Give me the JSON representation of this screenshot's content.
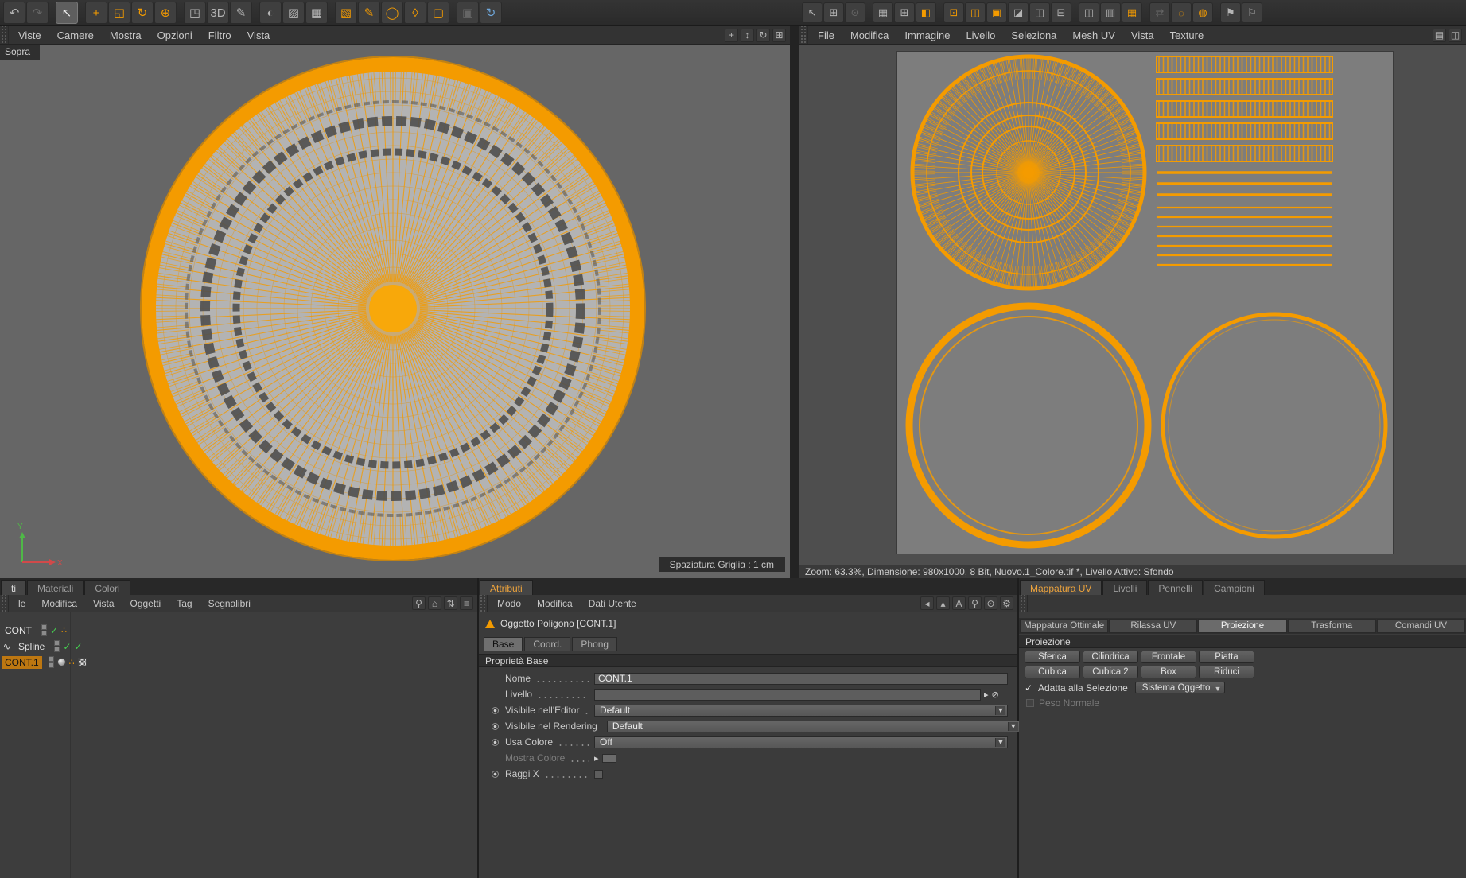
{
  "colors": {
    "accent": "#f49b00",
    "check_green": "#45d04f",
    "refresh_blue": "#6fa8dc",
    "selection_orange": "#bd7711"
  },
  "top_toolbar": {
    "left_icons": [
      {
        "name": "undo-icon",
        "glyph": "↶"
      },
      {
        "name": "redo-icon",
        "glyph": "↷",
        "dim": true
      },
      {
        "name": "sep"
      },
      {
        "name": "live-selection-icon",
        "glyph": "↖",
        "selected": true
      },
      {
        "name": "sep"
      },
      {
        "name": "move-icon",
        "glyph": "+",
        "orange": true
      },
      {
        "name": "scale-icon",
        "glyph": "◱",
        "orange": true
      },
      {
        "name": "rotate-icon",
        "glyph": "↻",
        "orange": true
      },
      {
        "name": "coordinates-icon",
        "glyph": "⊕",
        "orange": true
      },
      {
        "name": "sep"
      },
      {
        "name": "model-mode-icon",
        "glyph": "◳"
      },
      {
        "name": "pen-3d-icon",
        "glyph": "3D"
      },
      {
        "name": "paint-icon",
        "glyph": "✎"
      },
      {
        "name": "sep"
      },
      {
        "name": "render-view-icon",
        "glyph": "◐"
      },
      {
        "name": "render-settings-icon",
        "glyph": "▨"
      },
      {
        "name": "render-queue-icon",
        "glyph": "▦"
      },
      {
        "name": "sep"
      },
      {
        "name": "cube-primitive-icon",
        "glyph": "▧",
        "orange": true
      },
      {
        "name": "spline-pen-icon",
        "glyph": "✎",
        "orange": true
      },
      {
        "name": "generator-icon",
        "glyph": "◯",
        "orange": true
      },
      {
        "name": "deformer-icon",
        "glyph": "◊",
        "orange": true
      },
      {
        "name": "scene-object-icon",
        "glyph": "▢",
        "orange": true
      },
      {
        "name": "sep"
      },
      {
        "name": "snap-icon",
        "glyph": "▣",
        "dim": true
      },
      {
        "name": "refresh-icon",
        "glyph": "↻",
        "blue": true
      }
    ],
    "right_icons": [
      {
        "name": "uv-pointer-icon",
        "glyph": "↖"
      },
      {
        "name": "uv-grid-icon",
        "glyph": "⊞"
      },
      {
        "name": "uv-magnet-icon",
        "glyph": "⊙",
        "dim": true
      },
      {
        "name": "sep"
      },
      {
        "name": "checker-small-icon",
        "glyph": "▦"
      },
      {
        "name": "table-icon",
        "glyph": "⊞"
      },
      {
        "name": "half-orange-icon",
        "glyph": "◧",
        "orange": true
      },
      {
        "name": "sep"
      },
      {
        "name": "uv-point-mode-icon",
        "glyph": "⊡",
        "orange": true
      },
      {
        "name": "uv-edge-mode-icon",
        "glyph": "◫",
        "orange": true
      },
      {
        "name": "uv-poly-mode-icon",
        "glyph": "▣",
        "orange": true
      },
      {
        "name": "uv-cut-icon",
        "glyph": "◪"
      },
      {
        "name": "mirror-horizontal-icon",
        "glyph": "◫"
      },
      {
        "name": "mirror-vertical-icon",
        "glyph": "⊟"
      },
      {
        "name": "sep"
      },
      {
        "name": "layout-columns-icon",
        "glyph": "◫"
      },
      {
        "name": "layout-rows-icon",
        "glyph": "▥"
      },
      {
        "name": "layout-grid-icon",
        "glyph": "▦",
        "orange": true
      },
      {
        "name": "sep"
      },
      {
        "name": "swap-icon",
        "glyph": "⇄",
        "dim": true
      },
      {
        "name": "dotted-circle-icon",
        "glyph": "◌",
        "orange": true
      },
      {
        "name": "pattern-circle-icon",
        "glyph": "◍",
        "orange": true
      },
      {
        "name": "sep"
      },
      {
        "name": "flag-icon",
        "glyph": "⚑"
      },
      {
        "name": "flag-outline-icon",
        "glyph": "⚐"
      }
    ]
  },
  "left_viewport": {
    "menu": [
      "Viste",
      "Camere",
      "Mostra",
      "Opzioni",
      "Filtro",
      "Vista"
    ],
    "view_icons": [
      {
        "name": "pan-view-icon",
        "glyph": "+"
      },
      {
        "name": "zoom-view-icon",
        "glyph": "↕"
      },
      {
        "name": "rotate-view-icon",
        "glyph": "↻"
      },
      {
        "name": "toggle-layout-icon",
        "glyph": "⊞"
      }
    ],
    "view_label": "Sopra",
    "grid_spacing": "Spaziatura Griglia : 1 cm",
    "axis_labels": {
      "x": "X",
      "y": "Y"
    }
  },
  "uv_view": {
    "menu": [
      "File",
      "Modifica",
      "Immagine",
      "Livello",
      "Seleziona",
      "Mesh UV",
      "Vista",
      "Texture"
    ],
    "corner_icons": [
      {
        "name": "texture-list-icon",
        "glyph": "▤"
      },
      {
        "name": "split-view-icon",
        "glyph": "◫"
      }
    ],
    "status": "Zoom: 63.3%, Dimensione: 980x1000, 8 Bit, Nuovo.1_Colore.tif *, Livello Attivo: Sfondo"
  },
  "objects_panel": {
    "tabs": [
      {
        "label": "ti",
        "active": true
      },
      {
        "label": "Materiali",
        "active": false
      },
      {
        "label": "Colori",
        "active": false
      }
    ],
    "menu": [
      "le",
      "Modifica",
      "Vista",
      "Oggetti",
      "Tag",
      "Segnalibri"
    ],
    "corner_icons": [
      {
        "name": "search-icon",
        "glyph": "⚲"
      },
      {
        "name": "home-icon",
        "glyph": "⌂"
      },
      {
        "name": "sort-icon",
        "glyph": "⇅"
      },
      {
        "name": "panel-menu-icon",
        "glyph": "≡"
      }
    ],
    "items": [
      {
        "label": "CONT",
        "selected": false,
        "left_icon": "",
        "checks": 1,
        "tags": [
          "dots"
        ]
      },
      {
        "label": "Spline",
        "selected": false,
        "left_icon": "spline",
        "checks": 2,
        "tags": []
      },
      {
        "label": "CONT.1",
        "selected": true,
        "left_icon": "",
        "checks": 0,
        "tags": [
          "sphere",
          "dots",
          "checker"
        ]
      }
    ]
  },
  "attributes_panel": {
    "tab": "Attributi",
    "menu": [
      "Modo",
      "Modifica",
      "Dati Utente"
    ],
    "corner_icons": [
      {
        "name": "history-back-icon",
        "glyph": "◂"
      },
      {
        "name": "cone-nav-icon",
        "glyph": "▴"
      },
      {
        "name": "font-size-icon",
        "glyph": "A"
      },
      {
        "name": "search-icon",
        "glyph": "⚲"
      },
      {
        "name": "lock-icon",
        "glyph": "⊙"
      },
      {
        "name": "gear-icon",
        "glyph": "⚙"
      }
    ],
    "object_title": "Oggetto Poligono [CONT.1]",
    "object_tabs": [
      {
        "label": "Base",
        "active": true
      },
      {
        "label": "Coord.",
        "active": false
      },
      {
        "label": "Phong",
        "active": false
      }
    ],
    "section": "Proprietà Base",
    "fields": [
      {
        "label": "Nome",
        "control": "text",
        "value": "CONT.1",
        "toggle": false
      },
      {
        "label": "Livello",
        "control": "layer",
        "value": "",
        "toggle": false
      },
      {
        "label": "Visibile nell'Editor",
        "control": "select",
        "value": "Default",
        "toggle": true
      },
      {
        "label": "Visibile nel Rendering",
        "control": "select",
        "value": "Default",
        "toggle": true
      },
      {
        "label": "Usa Colore",
        "control": "select",
        "value": "Off",
        "toggle": true
      },
      {
        "label": "Mostra Colore",
        "control": "swatch",
        "toggle": false,
        "disabled": true
      },
      {
        "label": "Raggi X",
        "control": "checkbox",
        "checked": false,
        "toggle": true
      }
    ]
  },
  "uv_panel": {
    "tabs": [
      {
        "label": "Mappatura UV",
        "active": true,
        "accent": true
      },
      {
        "label": "Livelli",
        "active": false
      },
      {
        "label": "Pennelli",
        "active": false
      },
      {
        "label": "Campioni",
        "active": false
      }
    ],
    "mode_tabs": [
      {
        "label": "Mappatura Ottimale",
        "active": false
      },
      {
        "label": "Rilassa UV",
        "active": false
      },
      {
        "label": "Proiezione",
        "active": true
      },
      {
        "label": "Trasforma",
        "active": false
      },
      {
        "label": "Comandi UV",
        "active": false
      }
    ],
    "section": "Proiezione",
    "projection_buttons": [
      "Sferica",
      "Cilindrica",
      "Frontale",
      "Piatta",
      "Cubica",
      "Cubica 2",
      "Box",
      "Riduci"
    ],
    "checkbox_label": "Adatta alla Selezione",
    "checkbox_checked": true,
    "dropdown_value": "Sistema Oggetto",
    "disabled_label": "Peso Normale"
  }
}
